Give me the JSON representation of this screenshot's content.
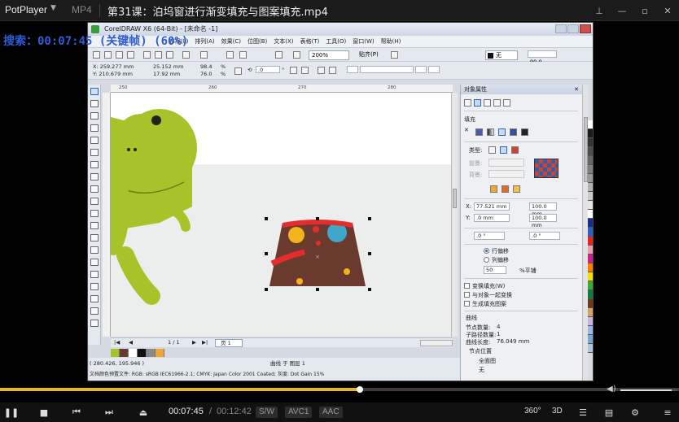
{
  "player": {
    "logo": "PotPlayer",
    "format": "MP4",
    "title": "第31课：泊坞窗进行渐变填充与图案填充.mp4",
    "window_buttons": [
      "pin-icon",
      "minimize-icon",
      "maximize-icon",
      "close-icon"
    ],
    "overlay": "搜索：00:07:45 (关键帧) (60%)",
    "current_time": "00:07:45",
    "separator": "/",
    "total_time": "00:12:42",
    "progress": 0.53,
    "volume": 0.9,
    "tags": [
      "S/W",
      "AVC1",
      "AAC"
    ],
    "right_controls": [
      "360°",
      "3D"
    ]
  },
  "corel": {
    "title": "CorelDRAW X6 (64-Bit) - [未命名 -1]",
    "menu": [
      "布局(L)",
      "排列(A)",
      "效果(C)",
      "位图(B)",
      "文本(X)",
      "表格(T)",
      "工具(O)",
      "窗口(W)",
      "帮助(H)"
    ],
    "zoom": "200%",
    "snap": "贴齐(P)",
    "outline": "无",
    "property_bar": {
      "x": "X: 259.277 mm",
      "y": "Y: 210.679 mm",
      "w": "25.152 mm",
      "h": "17.92 mm",
      "sx": "98.4",
      "sy": "76.0",
      "pct": "%",
      "angle": ".0",
      "angle_unit": "°",
      "outline_angle": "90.0"
    },
    "ruler_labels": [
      "250",
      "260",
      "270",
      "280"
    ],
    "page_indicator": "1 / 1",
    "page_tab": "页 1",
    "status_coords": "( 280.426, 195.946 )",
    "status_object": "曲线 于 图层 1",
    "status_color": "文档颜色预置文件: RGB: sRGB IEC61966-2.1; CMYK: Japan Color 2001 Coated; 灰度: Dot Gain 15%",
    "swatch_colors": [
      "#a6c32a",
      "#6b3a2f",
      "#ffffff",
      "#111111",
      "#8a8a8a",
      "#f2a634"
    ]
  },
  "docker": {
    "title": "对象属性",
    "section_fill": "填充",
    "type_label": "类型:",
    "front_label": "前景:",
    "back_label": "背景:",
    "x_label": "X:",
    "x_value": "77.521 mm",
    "y_label": "Y:",
    "y_value": ".0 mm",
    "w_value": "100.0 mm",
    "h_value": "100.0 mm",
    "rot_value": ".0 °",
    "skew_value": ".0 °",
    "row_offset": "行偏移",
    "col_offset": "列偏移",
    "offset_value": "50",
    "offset_unit": "%平铺",
    "cb_transform": "变换填充(W)",
    "cb_mirror": "与对象一起变换",
    "cb_spread": "生成填充图案",
    "section_curve": "曲线",
    "node_count": "节点数量:",
    "node_count_val": "4",
    "subpath": "子路径数量:",
    "subpath_val": "1",
    "curve_len": "曲线长度:",
    "curve_len_val": "76.049 mm",
    "node_pos": "节点位置",
    "all_label": "全面图",
    "none_label": "无"
  },
  "palette": [
    "#ffffff",
    "#1a1a1a",
    "#333333",
    "#4d4d4d",
    "#666666",
    "#808080",
    "#999999",
    "#b3b3b3",
    "#cccccc",
    "#e6e6e6",
    "#ffffff",
    "#1c2b8a",
    "#2a5fc4",
    "#e52420",
    "#e8a0b0",
    "#d0208a",
    "#ff7a00",
    "#f5e000",
    "#3aaa35",
    "#0b7a3a",
    "#6c3a1a",
    "#d9a066",
    "#c7b7e0",
    "#9fb7e8",
    "#7aa6d8",
    "#b0c4de"
  ]
}
